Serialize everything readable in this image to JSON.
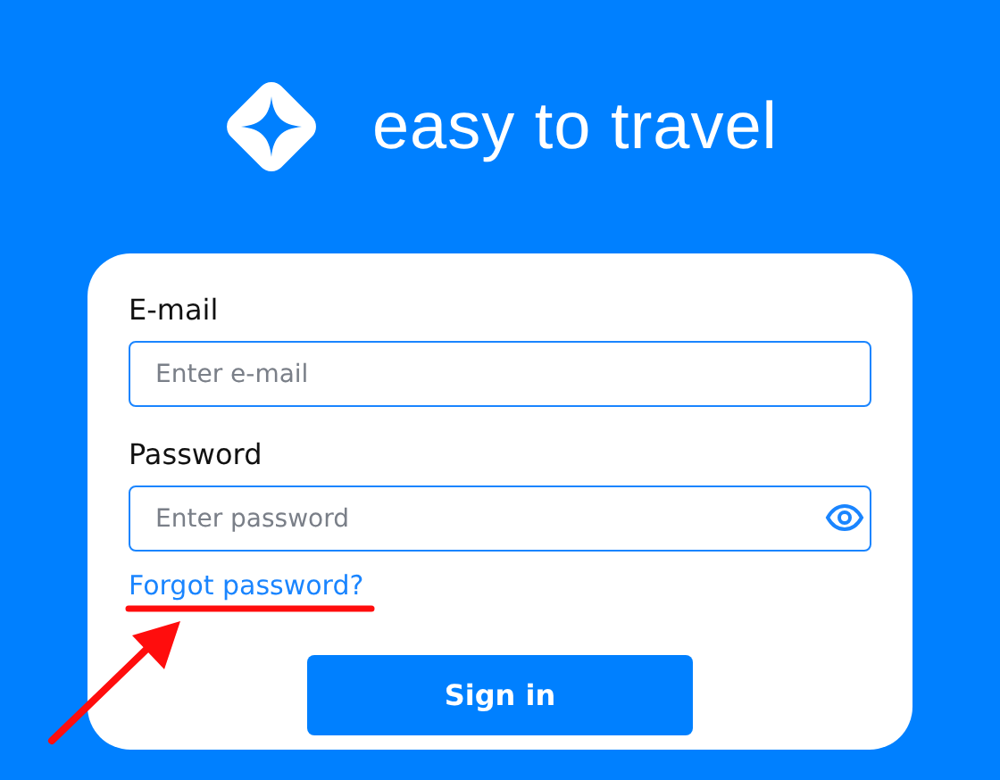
{
  "brand": {
    "name": "easy to travel"
  },
  "form": {
    "fields": [
      {
        "label": "E-mail",
        "placeholder": "Enter e-mail",
        "kind": "text"
      },
      {
        "label": "Password",
        "placeholder": "Enter password",
        "kind": "password"
      }
    ],
    "link": "Forgot password?",
    "submit": "Sign in"
  }
}
